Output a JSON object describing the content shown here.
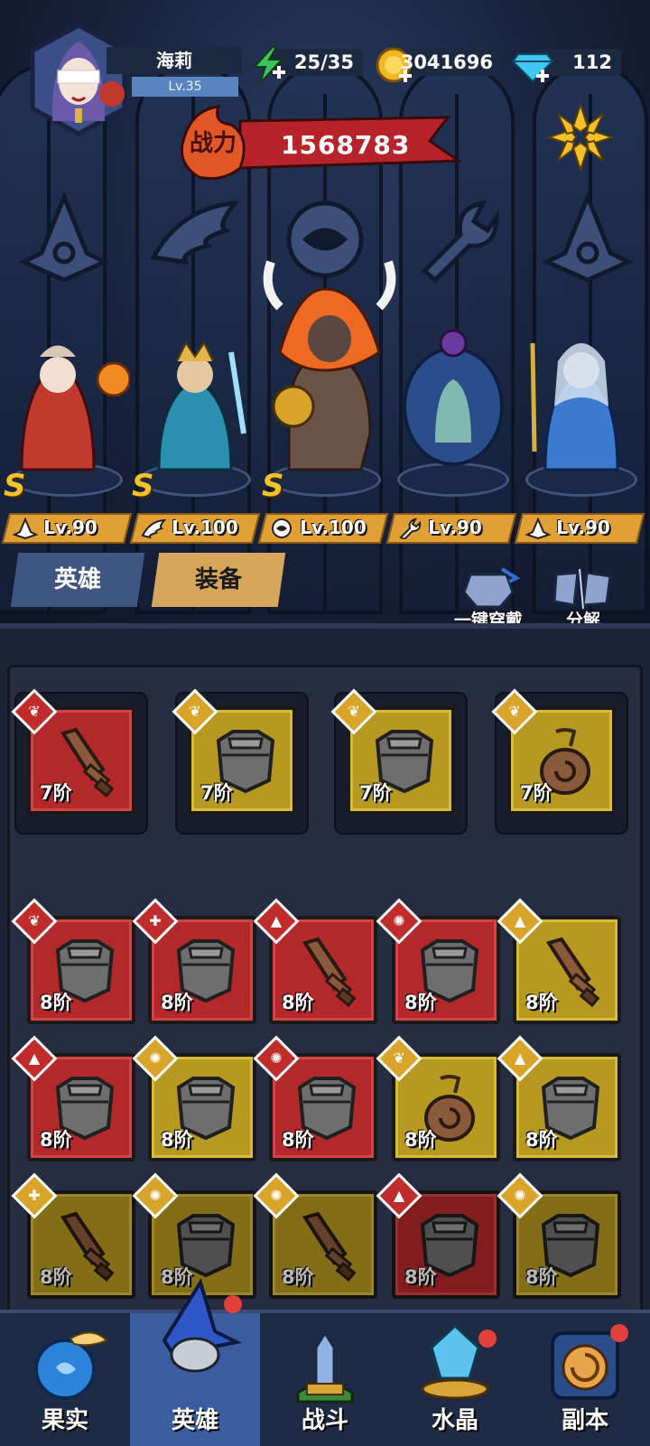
{
  "player": {
    "name": "海莉",
    "level": "Lv.35"
  },
  "resources": {
    "energy": "25/35",
    "gold": "3041696",
    "diamonds": "112"
  },
  "power": {
    "label": "战力",
    "value": "1568783"
  },
  "heroes": [
    {
      "level": "Lv.90",
      "rank": "S",
      "class_icon": "mage-hat-icon"
    },
    {
      "level": "Lv.100",
      "rank": "S",
      "class_icon": "wing-icon"
    },
    {
      "level": "Lv.100",
      "rank": "S",
      "class_icon": "beast-icon"
    },
    {
      "level": "Lv.90",
      "rank": "",
      "class_icon": "wrench-icon"
    },
    {
      "level": "Lv.90",
      "rank": "",
      "class_icon": "mage-hat-icon"
    }
  ],
  "tabs": {
    "hero": "英雄",
    "equipment": "装备"
  },
  "actions": {
    "equip_all": "一键穿戴",
    "decompose": "分解"
  },
  "equipped": [
    {
      "tier": "7阶",
      "color": "red",
      "type": "sword",
      "badge": "wing-icon"
    },
    {
      "tier": "7阶",
      "color": "gold",
      "type": "armor",
      "badge": "wing-icon"
    },
    {
      "tier": "7阶",
      "color": "gold",
      "type": "armor",
      "badge": "wing-icon"
    },
    {
      "tier": "7阶",
      "color": "gold",
      "type": "amulet",
      "badge": "wing-icon"
    }
  ],
  "inventory": [
    {
      "tier": "8阶",
      "color": "red",
      "type": "armor",
      "badge": "wing-icon"
    },
    {
      "tier": "8阶",
      "color": "red",
      "type": "armor",
      "badge": "wrench-icon"
    },
    {
      "tier": "8阶",
      "color": "red",
      "type": "sword",
      "badge": "mage-hat-icon"
    },
    {
      "tier": "8阶",
      "color": "red",
      "type": "armor",
      "badge": "beast-icon"
    },
    {
      "tier": "8阶",
      "color": "gold",
      "type": "sword",
      "badge": "mage-hat-icon"
    },
    {
      "tier": "8阶",
      "color": "red",
      "type": "armor",
      "badge": "mage-hat-icon"
    },
    {
      "tier": "8阶",
      "color": "gold",
      "type": "armor",
      "badge": "beast-icon"
    },
    {
      "tier": "8阶",
      "color": "red",
      "type": "armor",
      "badge": "beast-icon"
    },
    {
      "tier": "8阶",
      "color": "gold",
      "type": "amulet",
      "badge": "wing-icon"
    },
    {
      "tier": "8阶",
      "color": "gold",
      "type": "armor",
      "badge": "mage-hat-icon"
    },
    {
      "tier": "8阶",
      "color": "gold",
      "type": "sword",
      "badge": "wrench-icon"
    },
    {
      "tier": "8阶",
      "color": "gold",
      "type": "armor",
      "badge": "beast-icon"
    },
    {
      "tier": "8阶",
      "color": "gold",
      "type": "sword",
      "badge": "beast-icon"
    },
    {
      "tier": "8阶",
      "color": "red",
      "type": "armor",
      "badge": "mage-hat-icon"
    },
    {
      "tier": "8阶",
      "color": "gold",
      "type": "armor",
      "badge": "beast-icon"
    }
  ],
  "nav": [
    {
      "label": "果实",
      "icon": "fruit-icon"
    },
    {
      "label": "英雄",
      "icon": "hero-wizard-icon"
    },
    {
      "label": "战斗",
      "icon": "battle-icon"
    },
    {
      "label": "水晶",
      "icon": "crystal-icon"
    },
    {
      "label": "副本",
      "icon": "dungeon-portal-icon"
    }
  ],
  "colors": {
    "red_item": "#b3282b",
    "gold_item": "#b59920",
    "level_tag": "#e0a036",
    "active_nav": "#3b5da0"
  }
}
